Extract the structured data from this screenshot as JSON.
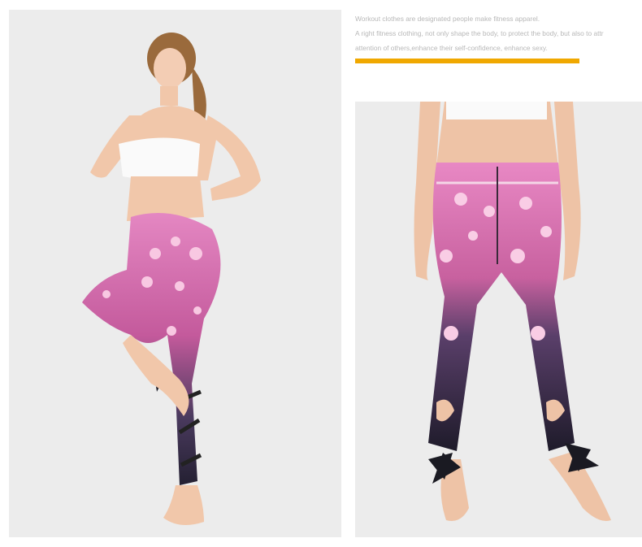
{
  "text": {
    "line1": "Workout clothes are designated people make fitness apparel.",
    "line2": "A right fitness clothing, not only shape the body, to protect the body, but also to attr",
    "line3": " attention of others,enhance their self-confidence, enhance sexy."
  },
  "colors": {
    "accent": "#f0a800",
    "background": "#ffffff",
    "photo_background": "#ececec",
    "text": "#b8b8b8"
  },
  "images": {
    "left": "woman-in-floral-leggings-pose",
    "right": "floral-leggings-rear-view"
  }
}
